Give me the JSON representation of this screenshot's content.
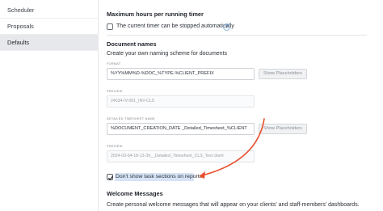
{
  "sidebar": {
    "items": [
      {
        "label": "Scheduler"
      },
      {
        "label": "Proposals"
      },
      {
        "label": "Defaults"
      }
    ]
  },
  "max_hours": {
    "title": "Maximum hours per running timer",
    "checkbox_label": "The current timer can be stopped automatically",
    "checked": false
  },
  "document_names": {
    "title": "Document names",
    "description": "Create your own naming scheme for documents",
    "format_label": "FORMAT",
    "format_value": "%YY%MM%D-%DOC_%TYPE-%CLIENT_PREFIX",
    "preview_label": "PREVIEW",
    "preview_value": "24034-IV-001_INV-CLS",
    "show_placeholders": "Show Placeholders",
    "timesheet_label": "DETAILED TIMESHEET NAME",
    "timesheet_value": "%DOCUMENT_CREATION_DATE _Detailed_Timesheet_%CLIENT",
    "timesheet_preview_label": "PREVIEW",
    "timesheet_preview_value": "2024-03-04-18-13-39__Detailed_Timesheet_CLS_Test client",
    "show_placeholders_2": "Show Placeholders"
  },
  "task_sections": {
    "checkbox_label": "Don't show task sections on reports",
    "checked": true
  },
  "welcome": {
    "title": "Welcome Messages",
    "description": "Create personal welcome messages that will appear on your clients' and staff-members' dashboards."
  },
  "colors": {
    "arrow": "#e8502e",
    "highlight": "#d7e3f6",
    "active_sidebar": "#e6e8eb"
  }
}
